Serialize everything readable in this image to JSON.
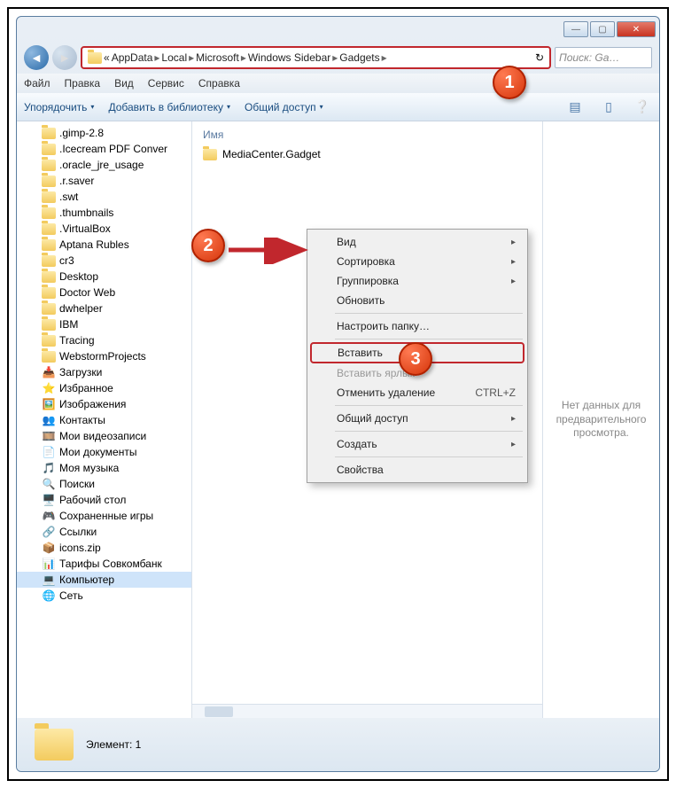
{
  "window": {
    "btn_min": "—",
    "btn_max": "▢",
    "btn_close": "✕"
  },
  "breadcrumb": {
    "lead": "«",
    "segs": [
      "AppData",
      "Local",
      "Microsoft",
      "Windows Sidebar",
      "Gadgets"
    ],
    "arw": "▸",
    "refresh": "↻"
  },
  "search": {
    "placeholder": "Поиск: Ga…"
  },
  "menu": {
    "file": "Файл",
    "edit": "Правка",
    "view": "Вид",
    "service": "Сервис",
    "help": "Справка"
  },
  "cmd": {
    "org": "Упорядочить",
    "lib": "Добавить в библиотеку",
    "share": "Общий доступ",
    "tri": "▾"
  },
  "tree": [
    {
      "label": ".gimp-2.8",
      "ico": "f"
    },
    {
      "label": ".Icecream PDF Conver",
      "ico": "f"
    },
    {
      "label": ".oracle_jre_usage",
      "ico": "f"
    },
    {
      "label": ".r.saver",
      "ico": "f"
    },
    {
      "label": ".swt",
      "ico": "f"
    },
    {
      "label": ".thumbnails",
      "ico": "f"
    },
    {
      "label": ".VirtualBox",
      "ico": "f"
    },
    {
      "label": "Aptana Rubles",
      "ico": "f"
    },
    {
      "label": "cr3",
      "ico": "f"
    },
    {
      "label": "Desktop",
      "ico": "f"
    },
    {
      "label": "Doctor Web",
      "ico": "f"
    },
    {
      "label": "dwhelper",
      "ico": "f"
    },
    {
      "label": "IBM",
      "ico": "f"
    },
    {
      "label": "Tracing",
      "ico": "f"
    },
    {
      "label": "WebstormProjects",
      "ico": "f"
    },
    {
      "label": "Загрузки",
      "ico": "s",
      "g": "📥"
    },
    {
      "label": "Избранное",
      "ico": "s",
      "g": "⭐"
    },
    {
      "label": "Изображения",
      "ico": "s",
      "g": "🖼️"
    },
    {
      "label": "Контакты",
      "ico": "s",
      "g": "👥"
    },
    {
      "label": "Мои видеозаписи",
      "ico": "s",
      "g": "🎞️"
    },
    {
      "label": "Мои документы",
      "ico": "s",
      "g": "📄"
    },
    {
      "label": "Моя музыка",
      "ico": "s",
      "g": "🎵"
    },
    {
      "label": "Поиски",
      "ico": "s",
      "g": "🔍"
    },
    {
      "label": "Рабочий стол",
      "ico": "s",
      "g": "🖥️"
    },
    {
      "label": "Сохраненные игры",
      "ico": "s",
      "g": "🎮"
    },
    {
      "label": "Ссылки",
      "ico": "s",
      "g": "🔗"
    },
    {
      "label": "icons.zip",
      "ico": "s",
      "g": "📦"
    },
    {
      "label": "Тарифы Совкомбанк",
      "ico": "s",
      "g": "📊"
    },
    {
      "label": "Компьютер",
      "ico": "s",
      "g": "💻",
      "sel": true
    },
    {
      "label": "Сеть",
      "ico": "s",
      "g": "🌐"
    }
  ],
  "col_name": "Имя",
  "file": "MediaCenter.Gadget",
  "preview": "Нет данных для предварительного просмотра.",
  "status": "Элемент: 1",
  "ctx": {
    "view": "Вид",
    "sort": "Сортировка",
    "group": "Группировка",
    "refresh": "Обновить",
    "custom": "Настроить папку…",
    "paste": "Вставить",
    "paste_lnk": "Вставить ярлык",
    "undo": "Отменить удаление",
    "undo_key": "CTRL+Z",
    "share": "Общий доступ",
    "create": "Создать",
    "props": "Свойства",
    "sub": "▸"
  },
  "badges": {
    "b1": "1",
    "b2": "2",
    "b3": "3"
  }
}
